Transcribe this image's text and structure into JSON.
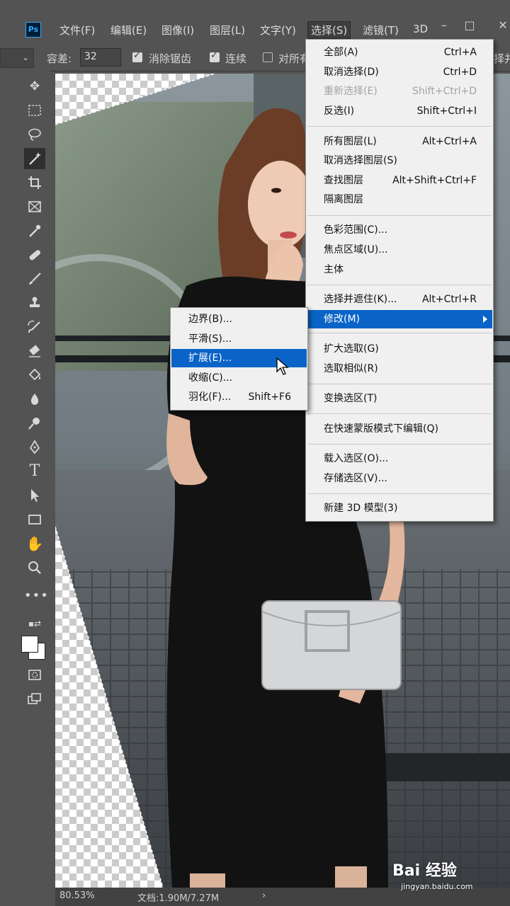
{
  "app": {
    "logo": "Ps"
  },
  "menubar": {
    "items": [
      "文件(F)",
      "编辑(E)",
      "图像(I)",
      "图层(L)",
      "文字(Y)",
      "选择(S)",
      "滤镜(T)",
      "3D"
    ],
    "window_buttons": [
      "–",
      "□",
      "✕"
    ]
  },
  "options": {
    "tolerance_label": "容差:",
    "tolerance_value": "32",
    "anti_alias_label": "消除锯齿",
    "contiguous_label": "连续",
    "sample_all_label": "对所有",
    "select_and_mask_label": "择并"
  },
  "tools": [
    "move-icon",
    "marquee-icon",
    "lasso-icon",
    "magic-wand-icon",
    "crop-icon",
    "frame-icon",
    "eyedropper-icon",
    "healing-icon",
    "brush-icon",
    "stamp-icon",
    "history-brush-icon",
    "eraser-icon",
    "paint-bucket-icon",
    "blur-icon",
    "dodge-icon",
    "pen-icon",
    "type-icon",
    "path-select-icon",
    "rectangle-icon",
    "hand-icon",
    "zoom-icon",
    "more-icon"
  ],
  "select_menu": {
    "items": [
      {
        "label": "全部(A)",
        "shortcut": "Ctrl+A"
      },
      {
        "label": "取消选择(D)",
        "shortcut": "Ctrl+D"
      },
      {
        "label": "重新选择(E)",
        "shortcut": "Shift+Ctrl+D",
        "disabled": true
      },
      {
        "label": "反选(I)",
        "shortcut": "Shift+Ctrl+I"
      },
      {
        "label": "所有图层(L)",
        "shortcut": "Alt+Ctrl+A"
      },
      {
        "label": "取消选择图层(S)",
        "shortcut": ""
      },
      {
        "label": "查找图层",
        "shortcut": "Alt+Shift+Ctrl+F"
      },
      {
        "label": "隔离图层",
        "shortcut": ""
      },
      {
        "label": "色彩范围(C)...",
        "shortcut": ""
      },
      {
        "label": "焦点区域(U)...",
        "shortcut": ""
      },
      {
        "label": "主体",
        "shortcut": ""
      },
      {
        "label": "选择并遮住(K)...",
        "shortcut": "Alt+Ctrl+R"
      },
      {
        "label": "修改(M)",
        "shortcut": "",
        "submenu": true
      },
      {
        "label": "扩大选取(G)",
        "shortcut": ""
      },
      {
        "label": "选取相似(R)",
        "shortcut": ""
      },
      {
        "label": "变换选区(T)",
        "shortcut": ""
      },
      {
        "label": "在快速蒙版模式下编辑(Q)",
        "shortcut": ""
      },
      {
        "label": "载入选区(O)...",
        "shortcut": ""
      },
      {
        "label": "存储选区(V)...",
        "shortcut": ""
      },
      {
        "label": "新建 3D 模型(3)",
        "shortcut": ""
      }
    ]
  },
  "modify_submenu": {
    "items": [
      {
        "label": "边界(B)...",
        "shortcut": ""
      },
      {
        "label": "平滑(S)...",
        "shortcut": ""
      },
      {
        "label": "扩展(E)...",
        "shortcut": "",
        "highlighted": true
      },
      {
        "label": "收缩(C)...",
        "shortcut": ""
      },
      {
        "label": "羽化(F)...",
        "shortcut": "Shift+F6"
      }
    ]
  },
  "status": {
    "zoom": "80.53%",
    "doc_info": "文档:1.90M/7.27M"
  },
  "watermark": {
    "text": "Bai 经验",
    "url": "jingyan.baidu.com"
  },
  "colors": {
    "highlight": "#0a64c8",
    "panel": "#535353",
    "menu_bg": "#f0f0f0"
  }
}
